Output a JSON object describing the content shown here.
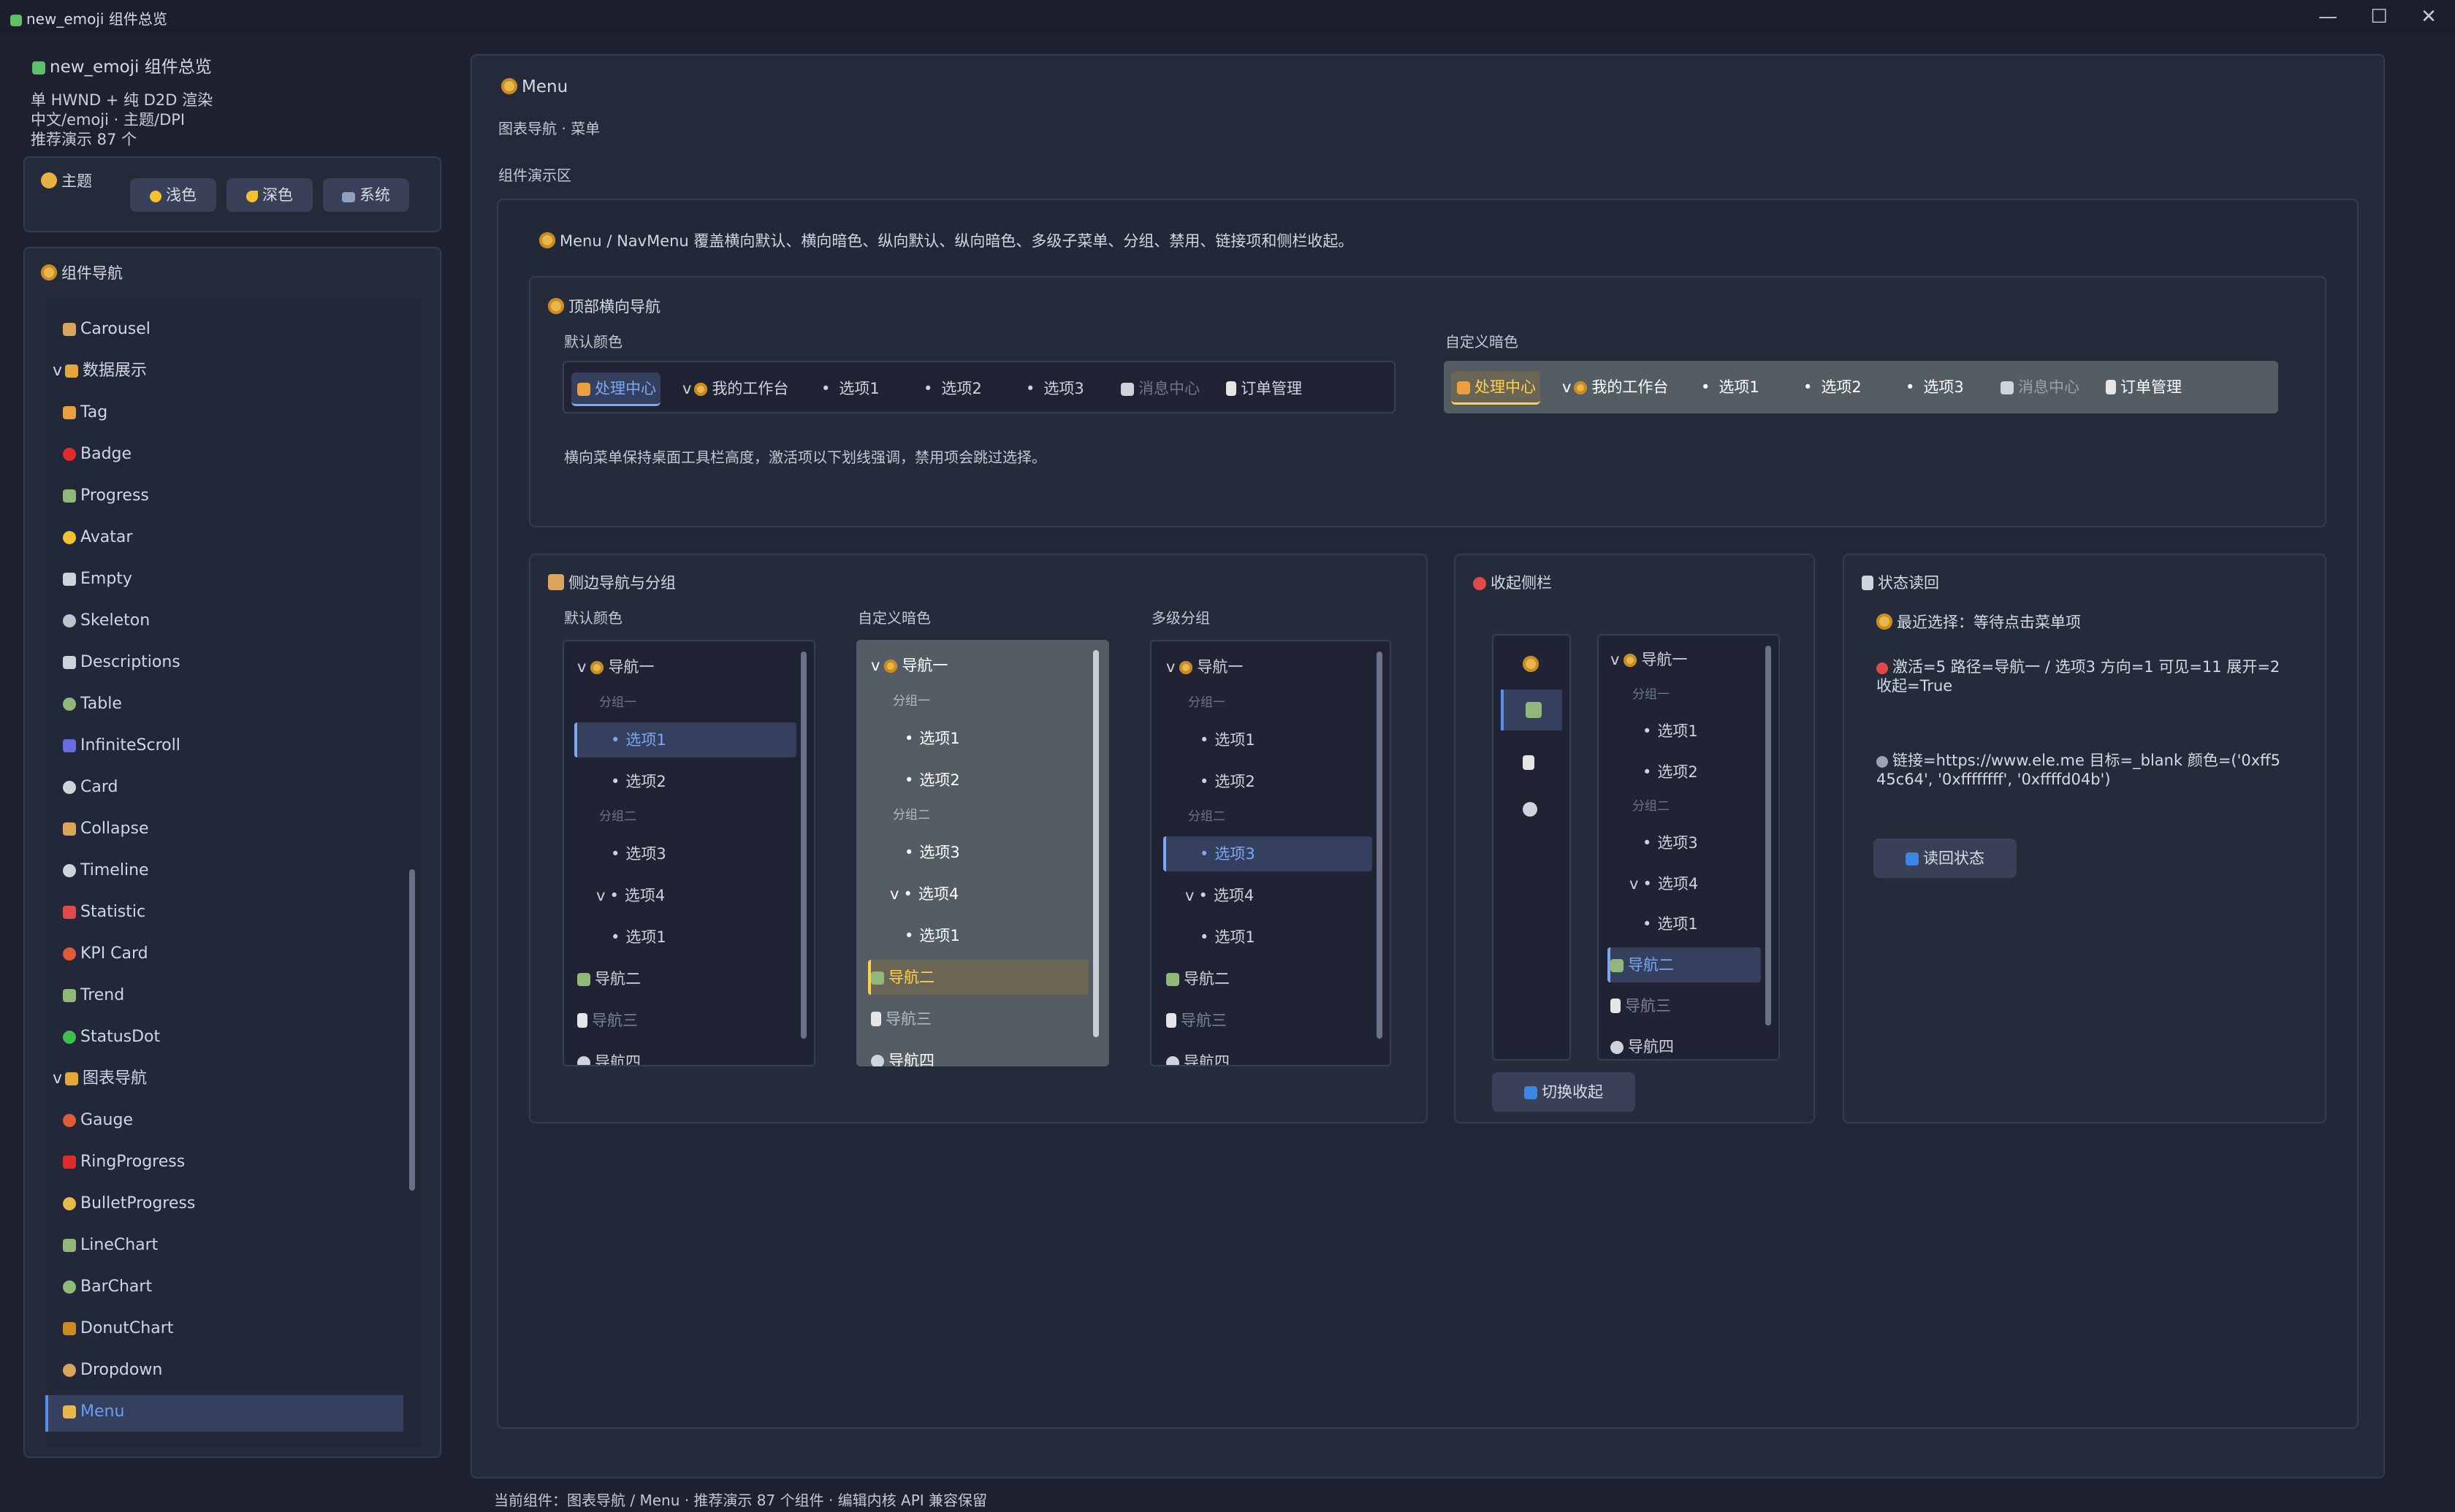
{
  "window": {
    "title": "new_emoji 组件总览",
    "min": "—",
    "max": "☐",
    "close": "✕"
  },
  "sidebar": {
    "app_title": "new_emoji 组件总览",
    "info": [
      "单 HWND + 纯 D2D 渲染",
      "中文/emoji · 主题/DPI",
      "推荐演示 87 个"
    ],
    "theme_label": "主题",
    "theme_buttons": [
      "浅色",
      "深色",
      "系统"
    ],
    "nav_title": "组件导航",
    "items": [
      {
        "label": "Carousel",
        "group": false
      },
      {
        "label": "数据展示",
        "group": true
      },
      {
        "label": "Tag",
        "group": false
      },
      {
        "label": "Badge",
        "group": false
      },
      {
        "label": "Progress",
        "group": false
      },
      {
        "label": "Avatar",
        "group": false
      },
      {
        "label": "Empty",
        "group": false
      },
      {
        "label": "Skeleton",
        "group": false
      },
      {
        "label": "Descriptions",
        "group": false
      },
      {
        "label": "Table",
        "group": false
      },
      {
        "label": "InfiniteScroll",
        "group": false
      },
      {
        "label": "Card",
        "group": false
      },
      {
        "label": "Collapse",
        "group": false
      },
      {
        "label": "Timeline",
        "group": false
      },
      {
        "label": "Statistic",
        "group": false
      },
      {
        "label": "KPI Card",
        "group": false
      },
      {
        "label": "Trend",
        "group": false
      },
      {
        "label": "StatusDot",
        "group": false
      },
      {
        "label": "图表导航",
        "group": true
      },
      {
        "label": "Gauge",
        "group": false
      },
      {
        "label": "RingProgress",
        "group": false
      },
      {
        "label": "BulletProgress",
        "group": false
      },
      {
        "label": "LineChart",
        "group": false
      },
      {
        "label": "BarChart",
        "group": false
      },
      {
        "label": "DonutChart",
        "group": false
      },
      {
        "label": "Dropdown",
        "group": false
      },
      {
        "label": "Menu",
        "group": false
      }
    ],
    "selected": "Menu"
  },
  "main": {
    "title": "Menu",
    "subtitle": "图表导航 · 菜单",
    "demo_label": "组件演示区",
    "intro": "Menu / NavMenu 覆盖横向默认、横向暗色、纵向默认、纵向暗色、多级子菜单、分组、禁用、链接项和侧栏收起。",
    "top": {
      "title": "顶部横向导航",
      "default_label": "默认颜色",
      "dark_label": "自定义暗色",
      "items": [
        "处理中心",
        "我的工作台",
        "选项1",
        "选项2",
        "选项3",
        "消息中心",
        "订单管理"
      ],
      "note": "横向菜单保持桌面工具栏高度，激活项以下划线强调，禁用项会跳过选择。"
    },
    "side": {
      "title": "侧边导航与分组",
      "col_labels": [
        "默认颜色",
        "自定义暗色",
        "多级分组"
      ],
      "nav1": "导航一",
      "group1": "分组一",
      "group2": "分组二",
      "opt1": "选项1",
      "opt2": "选项2",
      "opt3": "选项3",
      "opt4": "选项4",
      "opt41": "选项1",
      "nav2": "导航二",
      "nav3": "导航三",
      "nav4": "导航四"
    },
    "collapse": {
      "title": "收起侧栏",
      "toggle": "切换收起"
    },
    "status": {
      "title": "状态读回",
      "recent": "最近选择：等待点击菜单项",
      "state": "激活=5 路径=导航一 / 选项3 方向=1 可见=11 展开=2 收起=True",
      "link": "链接=https://www.ele.me 目标=_blank 颜色=('0xff545c64', '0xffffffff', '0xffffd04b')",
      "readback": "读回状态"
    }
  },
  "footer": "当前组件：图表导航 / Menu · 推荐演示 87 个组件 · 编辑内核 API 兼容保留"
}
